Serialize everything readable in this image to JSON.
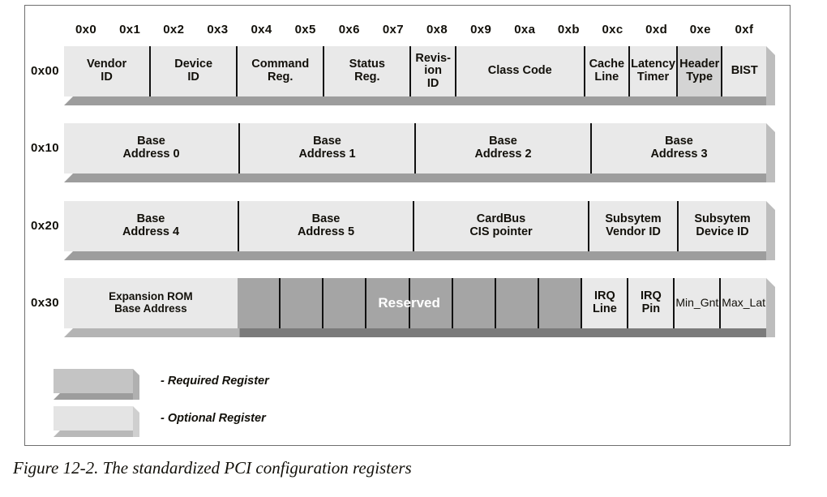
{
  "figure": {
    "caption": "Figure 12-2. The standardized PCI configuration registers",
    "column_headers": [
      "0x0",
      "0x1",
      "0x2",
      "0x3",
      "0x4",
      "0x5",
      "0x6",
      "0x7",
      "0x8",
      "0x9",
      "0xa",
      "0xb",
      "0xc",
      "0xd",
      "0xe",
      "0xf"
    ],
    "row_labels": [
      "0x00",
      "0x10",
      "0x20",
      "0x30"
    ],
    "colors": {
      "required_register": "#d4d4d4",
      "optional_register": "#e9e9e9",
      "reserved": "#a5a5a5",
      "cell_divider": "#111111",
      "frame_border": "#6f6f6f",
      "shadow": "#9d9d9d",
      "text": "#12100a",
      "reserved_text": "#ffffff"
    },
    "rows": [
      {
        "offset": "0x00",
        "cells": [
          {
            "label": "Vendor\nID",
            "bytes": 2,
            "style": "optional"
          },
          {
            "label": "Device\nID",
            "bytes": 2,
            "style": "optional"
          },
          {
            "label": "Command\nReg.",
            "bytes": 2,
            "style": "optional"
          },
          {
            "label": "Status\nReg.",
            "bytes": 2,
            "style": "optional"
          },
          {
            "label": "Revis-\nion\nID",
            "bytes": 1,
            "style": "optional"
          },
          {
            "label": "Class Code",
            "bytes": 3,
            "style": "optional"
          },
          {
            "label": "Cache\nLine",
            "bytes": 1,
            "style": "optional"
          },
          {
            "label": "Latency\nTimer",
            "bytes": 1,
            "style": "optional"
          },
          {
            "label": "Header\nType",
            "bytes": 1,
            "style": "required"
          },
          {
            "label": "BIST",
            "bytes": 1,
            "style": "optional"
          }
        ]
      },
      {
        "offset": "0x10",
        "cells": [
          {
            "label": "Base\nAddress 0",
            "bytes": 4,
            "style": "optional"
          },
          {
            "label": "Base\nAddress 1",
            "bytes": 4,
            "style": "optional"
          },
          {
            "label": "Base\nAddress 2",
            "bytes": 4,
            "style": "optional"
          },
          {
            "label": "Base\nAddress 3",
            "bytes": 4,
            "style": "optional"
          }
        ]
      },
      {
        "offset": "0x20",
        "cells": [
          {
            "label": "Base\nAddress 4",
            "bytes": 4,
            "style": "optional"
          },
          {
            "label": "Base\nAddress 5",
            "bytes": 4,
            "style": "optional"
          },
          {
            "label": "CardBus\nCIS pointer",
            "bytes": 4,
            "style": "optional"
          },
          {
            "label": "Subsytem\nVendor ID",
            "bytes": 2,
            "style": "optional"
          },
          {
            "label": "Subsytem\nDevice ID",
            "bytes": 2,
            "style": "optional"
          }
        ]
      },
      {
        "offset": "0x30",
        "cells": [
          {
            "label": "Expansion ROM\nBase Address",
            "bytes": 4,
            "style": "optional"
          },
          {
            "label": "Reserved",
            "bytes": 8,
            "style": "reserved",
            "subdivided": 8
          },
          {
            "label": "IRQ\nLine",
            "bytes": 1,
            "style": "optional"
          },
          {
            "label": "IRQ\nPin",
            "bytes": 1,
            "style": "optional"
          },
          {
            "label": "Min_Gnt",
            "bytes": 1,
            "style": "optional",
            "weight": "light"
          },
          {
            "label": "Max_Lat",
            "bytes": 1,
            "style": "optional",
            "weight": "light"
          }
        ]
      }
    ],
    "legend": [
      {
        "swatch": "required",
        "text": "- Required Register"
      },
      {
        "swatch": "optional",
        "text": "- Optional Register"
      }
    ]
  }
}
